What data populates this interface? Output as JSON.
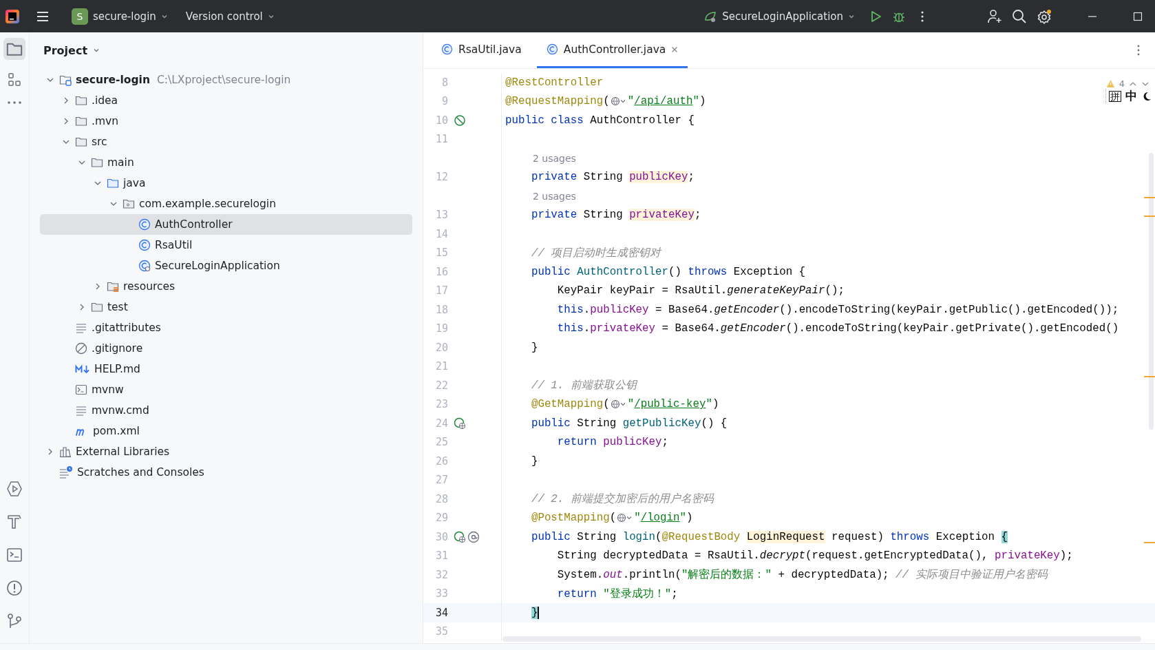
{
  "title_bar": {
    "project_badge": "S",
    "project": "secure-login",
    "vcs": "Version control",
    "run_config": "SecureLoginApplication"
  },
  "project": {
    "title": "Project",
    "tree": [
      {
        "label": "secure-login",
        "path": "C:\\LXproject\\secure-login",
        "kind": "module",
        "expanded": true,
        "selected": false,
        "children": [
          {
            "label": ".idea",
            "kind": "folder",
            "expanded": false,
            "selected": false
          },
          {
            "label": ".mvn",
            "kind": "folder",
            "expanded": false,
            "selected": false
          },
          {
            "label": "src",
            "kind": "folder",
            "expanded": true,
            "selected": false,
            "children": [
              {
                "label": "main",
                "kind": "folder",
                "expanded": true,
                "selected": false,
                "children": [
                  {
                    "label": "java",
                    "kind": "source",
                    "expanded": true,
                    "selected": false,
                    "children": [
                      {
                        "label": "com.example.securelogin",
                        "kind": "package",
                        "expanded": true,
                        "selected": false,
                        "children": [
                          {
                            "label": "AuthController",
                            "kind": "class",
                            "selected": true
                          },
                          {
                            "label": "RsaUtil",
                            "kind": "class",
                            "selected": false
                          },
                          {
                            "label": "SecureLoginApplication",
                            "kind": "app",
                            "selected": false
                          }
                        ]
                      }
                    ]
                  },
                  {
                    "label": "resources",
                    "kind": "resources",
                    "expanded": false,
                    "selected": false
                  }
                ]
              },
              {
                "label": "test",
                "kind": "folder",
                "expanded": false,
                "selected": false
              }
            ]
          },
          {
            "label": ".gitattributes",
            "kind": "text",
            "selected": false
          },
          {
            "label": ".gitignore",
            "kind": "ignore",
            "selected": false
          },
          {
            "label": "HELP.md",
            "kind": "markdown",
            "selected": false
          },
          {
            "label": "mvnw",
            "kind": "script",
            "selected": false
          },
          {
            "label": "mvnw.cmd",
            "kind": "text",
            "selected": false
          },
          {
            "label": "pom.xml",
            "kind": "maven",
            "selected": false
          }
        ]
      },
      {
        "label": "External Libraries",
        "kind": "libraries",
        "expanded": false,
        "selected": false
      },
      {
        "label": "Scratches and Consoles",
        "kind": "scratches",
        "selected": false
      }
    ]
  },
  "tabs": [
    {
      "label": "RsaUtil.java",
      "selected": false
    },
    {
      "label": "AuthController.java",
      "selected": true
    }
  ],
  "ime_toolbar": [
    "拼",
    "中"
  ],
  "inspections": {
    "warnings": "4"
  },
  "editor": {
    "lines": [
      {
        "number": "8",
        "tokens": [
          {
            "kind": "ann",
            "t": "@RestController"
          }
        ]
      },
      {
        "number": "9",
        "tokens": [
          {
            "kind": "ann",
            "t": "@RequestMapping"
          },
          {
            "kind": "plain",
            "t": "("
          },
          {
            "kind": "globe"
          },
          {
            "kind": "str",
            "t": "\""
          },
          {
            "kind": "url",
            "t": "/api/auth"
          },
          {
            "kind": "str",
            "t": "\""
          },
          {
            "kind": "plain",
            "t": ")"
          }
        ]
      },
      {
        "number": "10",
        "bean_marker": true,
        "tokens": [
          {
            "kind": "kw",
            "t": "public class "
          },
          {
            "kind": "plain",
            "t": "AuthController {"
          }
        ]
      },
      {
        "number": "11"
      },
      {
        "kind": "hint",
        "text": "2 usages"
      },
      {
        "number": "12",
        "tokens": [
          {
            "kind": "kw",
            "t": "    private"
          },
          {
            "kind": "plain",
            "t": " String "
          },
          {
            "kind": "field-hl",
            "t": "publicKey"
          },
          {
            "kind": "plain",
            "t": ";"
          }
        ]
      },
      {
        "kind": "hint",
        "text": "2 usages"
      },
      {
        "number": "13",
        "tokens": [
          {
            "kind": "kw",
            "t": "    private"
          },
          {
            "kind": "plain",
            "t": " String "
          },
          {
            "kind": "field-hl",
            "t": "privateKey"
          },
          {
            "kind": "plain",
            "t": ";"
          }
        ]
      },
      {
        "number": "14"
      },
      {
        "number": "15",
        "tokens": [
          {
            "kind": "comment",
            "t": "    // 项目启动时生成密钥对"
          }
        ]
      },
      {
        "number": "16",
        "tokens": [
          {
            "kind": "kw",
            "t": "    public "
          },
          {
            "kind": "decl",
            "t": "AuthController"
          },
          {
            "kind": "plain",
            "t": "() "
          },
          {
            "kind": "kw",
            "t": "throws"
          },
          {
            "kind": "plain",
            "t": " Exception {"
          }
        ]
      },
      {
        "number": "17",
        "tokens": [
          {
            "kind": "plain",
            "t": "        KeyPair keyPair = RsaUtil."
          },
          {
            "kind": "static",
            "t": "generateKeyPair"
          },
          {
            "kind": "plain",
            "t": "();"
          }
        ]
      },
      {
        "number": "18",
        "tokens": [
          {
            "kind": "kw",
            "t": "        this"
          },
          {
            "kind": "plain",
            "t": "."
          },
          {
            "kind": "field",
            "t": "publicKey"
          },
          {
            "kind": "plain",
            "t": " = Base64."
          },
          {
            "kind": "static",
            "t": "getEncoder"
          },
          {
            "kind": "plain",
            "t": "().encodeToString(keyPair.getPublic().getEncoded());"
          }
        ]
      },
      {
        "number": "19",
        "tokens": [
          {
            "kind": "kw",
            "t": "        this"
          },
          {
            "kind": "plain",
            "t": "."
          },
          {
            "kind": "field",
            "t": "privateKey"
          },
          {
            "kind": "plain",
            "t": " = Base64."
          },
          {
            "kind": "static",
            "t": "getEncoder"
          },
          {
            "kind": "plain",
            "t": "().encodeToString(keyPair.getPrivate().getEncoded()"
          }
        ]
      },
      {
        "number": "20",
        "tokens": [
          {
            "kind": "plain",
            "t": "    }"
          }
        ]
      },
      {
        "number": "21"
      },
      {
        "number": "22",
        "tokens": [
          {
            "kind": "comment",
            "t": "    // 1. 前端获取公钥"
          }
        ]
      },
      {
        "number": "23",
        "tokens": [
          {
            "kind": "ann",
            "t": "    @GetMapping"
          },
          {
            "kind": "plain",
            "t": "("
          },
          {
            "kind": "globe"
          },
          {
            "kind": "str",
            "t": "\""
          },
          {
            "kind": "url",
            "t": "/public-key"
          },
          {
            "kind": "str",
            "t": "\""
          },
          {
            "kind": "plain",
            "t": ")"
          }
        ]
      },
      {
        "number": "24",
        "endpoint_marker": true,
        "tokens": [
          {
            "kind": "kw",
            "t": "    public"
          },
          {
            "kind": "plain",
            "t": " String "
          },
          {
            "kind": "decl",
            "t": "getPublicKey"
          },
          {
            "kind": "plain",
            "t": "() {"
          }
        ]
      },
      {
        "number": "25",
        "tokens": [
          {
            "kind": "kw",
            "t": "        return "
          },
          {
            "kind": "field",
            "t": "publicKey"
          },
          {
            "kind": "plain",
            "t": ";"
          }
        ]
      },
      {
        "number": "26",
        "tokens": [
          {
            "kind": "plain",
            "t": "    }"
          }
        ]
      },
      {
        "number": "27"
      },
      {
        "number": "28",
        "tokens": [
          {
            "kind": "comment",
            "t": "    // 2. 前端提交加密后的用户名密码"
          }
        ]
      },
      {
        "number": "29",
        "tokens": [
          {
            "kind": "ann",
            "t": "    @PostMapping"
          },
          {
            "kind": "plain",
            "t": "("
          },
          {
            "kind": "globe"
          },
          {
            "kind": "str",
            "t": "\""
          },
          {
            "kind": "url",
            "t": "/login"
          },
          {
            "kind": "str",
            "t": "\""
          },
          {
            "kind": "plain",
            "t": ")"
          }
        ]
      },
      {
        "number": "30",
        "endpoint_marker": true,
        "inject_marker": true,
        "tokens": [
          {
            "kind": "kw",
            "t": "    public"
          },
          {
            "kind": "plain",
            "t": " String "
          },
          {
            "kind": "decl",
            "t": "login"
          },
          {
            "kind": "plain",
            "t": "("
          },
          {
            "kind": "ann",
            "t": "@RequestBody "
          },
          {
            "kind": "type-hl",
            "t": "LoginRequest"
          },
          {
            "kind": "plain",
            "t": " request) "
          },
          {
            "kind": "kw",
            "t": "throws"
          },
          {
            "kind": "plain",
            "t": " Exception "
          },
          {
            "kind": "brace",
            "t": "{"
          }
        ]
      },
      {
        "number": "31",
        "tokens": [
          {
            "kind": "plain",
            "t": "        String decryptedData = RsaUtil."
          },
          {
            "kind": "static",
            "t": "decrypt"
          },
          {
            "kind": "plain",
            "t": "(request.getEncryptedData(), "
          },
          {
            "kind": "field",
            "t": "privateKey"
          },
          {
            "kind": "plain",
            "t": ");"
          }
        ]
      },
      {
        "number": "32",
        "tokens": [
          {
            "kind": "plain",
            "t": "        System."
          },
          {
            "kind": "static-field",
            "t": "out"
          },
          {
            "kind": "plain",
            "t": ".println("
          },
          {
            "kind": "str",
            "t": "\"解密后的数据：\""
          },
          {
            "kind": "plain",
            "t": " + decryptedData); "
          },
          {
            "kind": "comment",
            "t": "// 实际项目中验证用户名密码"
          }
        ]
      },
      {
        "number": "33",
        "tokens": [
          {
            "kind": "kw",
            "t": "        return "
          },
          {
            "kind": "str",
            "t": "\"登录成功！\""
          },
          {
            "kind": "plain",
            "t": ";"
          }
        ]
      },
      {
        "number": "34",
        "current": true,
        "tokens": [
          {
            "kind": "brace",
            "t": "    }"
          }
        ]
      },
      {
        "number": "35"
      }
    ]
  }
}
